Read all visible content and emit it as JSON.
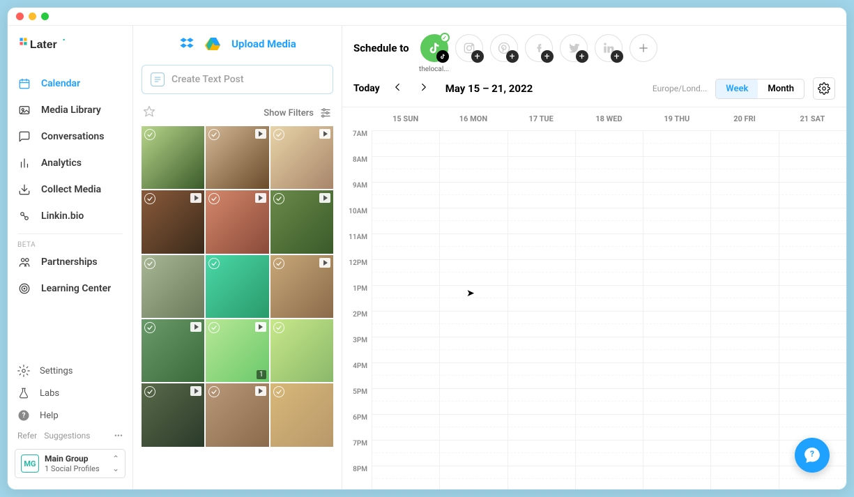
{
  "sidebar": {
    "nav": [
      {
        "label": "Calendar",
        "icon": "calendar-icon",
        "active": true
      },
      {
        "label": "Media Library",
        "icon": "image-icon"
      },
      {
        "label": "Conversations",
        "icon": "chat-icon"
      },
      {
        "label": "Analytics",
        "icon": "bar-chart-icon"
      },
      {
        "label": "Collect Media",
        "icon": "download-icon"
      },
      {
        "label": "Linkin.bio",
        "icon": "link-icon"
      }
    ],
    "beta_label": "BETA",
    "beta_nav": [
      {
        "label": "Partnerships",
        "icon": "people-icon"
      },
      {
        "label": "Learning Center",
        "icon": "target-icon"
      }
    ],
    "secondary": [
      {
        "label": "Settings",
        "icon": "gear-icon"
      },
      {
        "label": "Labs",
        "icon": "flask-icon"
      },
      {
        "label": "Help",
        "icon": "question-icon"
      }
    ],
    "footer": {
      "refer": "Refer",
      "suggestions": "Suggestions"
    },
    "group": {
      "badge": "MG",
      "title": "Main Group",
      "subtitle": "1 Social Profiles"
    }
  },
  "media": {
    "upload_label": "Upload Media",
    "text_post_placeholder": "Create Text Post",
    "filters_label": "Show Filters",
    "thumbs": [
      {
        "bg": [
          "#b8d68a",
          "#3a5a2a"
        ],
        "video": false
      },
      {
        "bg": [
          "#d4b896",
          "#6a4a2a"
        ],
        "video": true
      },
      {
        "bg": [
          "#e8d4a8",
          "#a8856a"
        ],
        "video": true
      },
      {
        "bg": [
          "#8a5a3a",
          "#3a2a1a"
        ],
        "video": true
      },
      {
        "bg": [
          "#d4886a",
          "#8a4a3a"
        ],
        "video": true
      },
      {
        "bg": [
          "#6a8a4a",
          "#3a5a2a"
        ],
        "video": true
      },
      {
        "bg": [
          "#a8b896",
          "#6a7a5a"
        ],
        "video": false
      },
      {
        "bg": [
          "#4ad8a8",
          "#2a9a6a"
        ],
        "video": false
      },
      {
        "bg": [
          "#c8a878",
          "#8a6a4a"
        ],
        "video": true
      },
      {
        "bg": [
          "#6a9a6a",
          "#3a6a3a"
        ],
        "video": true
      },
      {
        "bg": [
          "#b8e896",
          "#6ac86a"
        ],
        "video": true,
        "count": "1"
      },
      {
        "bg": [
          "#c8e88a",
          "#8ab86a"
        ],
        "video": false
      },
      {
        "bg": [
          "#5a6a4a",
          "#2a3a2a"
        ],
        "video": true
      },
      {
        "bg": [
          "#b89878",
          "#8a6a4a"
        ],
        "video": true
      },
      {
        "bg": [
          "#d8b878",
          "#b8986a"
        ],
        "video": false
      }
    ]
  },
  "calendar": {
    "schedule_label": "Schedule to",
    "socials": [
      {
        "name": "tiktok",
        "active": true,
        "handle": "thelocal..."
      },
      {
        "name": "instagram"
      },
      {
        "name": "pinterest"
      },
      {
        "name": "facebook"
      },
      {
        "name": "twitter"
      },
      {
        "name": "linkedin"
      }
    ],
    "today_label": "Today",
    "date_range": "May 15 – 21, 2022",
    "tz": "Europe/Lond...",
    "view_week": "Week",
    "view_month": "Month",
    "days": [
      "15 SUN",
      "16 MON",
      "17 TUE",
      "18 WED",
      "19 THU",
      "20 FRI",
      "21 SAT"
    ],
    "hours": [
      "7AM",
      "8AM",
      "9AM",
      "10AM",
      "11AM",
      "12PM",
      "1PM",
      "2PM",
      "3PM",
      "4PM",
      "5PM",
      "6PM",
      "7PM",
      "8PM"
    ]
  }
}
